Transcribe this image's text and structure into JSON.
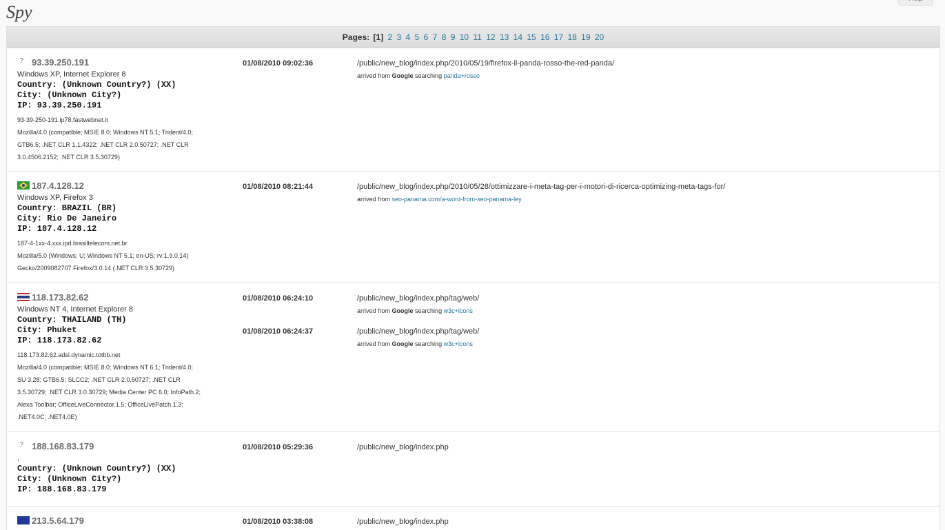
{
  "title": "Spy",
  "help_label": "Help",
  "pager": {
    "label": "Pages:",
    "current": "[1]",
    "pages": [
      "2",
      "3",
      "4",
      "5",
      "6",
      "7",
      "8",
      "9",
      "10",
      "11",
      "12",
      "13",
      "14",
      "15",
      "16",
      "17",
      "18",
      "19",
      "20"
    ]
  },
  "visits": [
    {
      "flag": "unknown",
      "flag_text": "?",
      "ip": "93.39.250.191",
      "os": "Windows XP, Internet Explorer 8",
      "country": "Country: (Unknown Country?) (XX)",
      "city": "City: (Unknown City?)",
      "ip_line": "IP: 93.39.250.191",
      "host": "93-39-250-191.ip78.fastwebnet.it",
      "ua": [
        "Mozilla/4.0 (compatible; MSIE 8.0; Windows NT 5.1; Trident/4.0;",
        "GTB6.5; .NET CLR 1.1.4322; .NET CLR 2.0.50727; .NET CLR",
        "3.0.4506.2152; .NET CLR 3.5.30729)"
      ],
      "hits": [
        {
          "time": "01/08/2010 09:02:36",
          "url": "/public/new_blog/index.php/2010/05/19/firefox-il-panda-rosso-the-red-panda/",
          "ref_prefix": "arrived from",
          "ref_engine": "Google",
          "ref_mid": "searching",
          "ref_link": "panda+rosso"
        }
      ]
    },
    {
      "flag": "br",
      "ip": "187.4.128.12",
      "os": "Windows XP, Firefox 3",
      "country": "Country: BRAZIL (BR)",
      "city": "City: Rio De Janeiro",
      "ip_line": "IP: 187.4.128.12",
      "host": "187-4-1xx-4.xxx.ipd.brasiltelecom.net.br",
      "ua": [
        "Mozilla/5.0 (Windows; U; Windows NT 5.1; en-US; rv:1.9.0.14)",
        "Gecko/2009082707 Firefox/3.0.14 (.NET CLR 3.5.30729)"
      ],
      "hits": [
        {
          "time": "01/08/2010 08:21:44",
          "url": "/public/new_blog/index.php/2010/05/28/ottimizzare-i-meta-tag-per-i-motori-di-ricerca-optimizing-meta-tags-for/",
          "ref_prefix": "arrived from",
          "ref_engine": "",
          "ref_mid": "",
          "ref_link": "seo-panama.com/a-word-from-seo-panama-ley"
        }
      ]
    },
    {
      "flag": "th",
      "ip": "118.173.82.62",
      "os": "Windows NT 4, Internet Explorer 8",
      "country": "Country: THAILAND (TH)",
      "city": "City: Phuket",
      "ip_line": "IP: 118.173.82.62",
      "host": "118.173.82.62.adsl.dynamic.totbb.net",
      "ua": [
        "Mozilla/4.0 (compatible; MSIE 8.0; Windows NT 6.1; Trident/4.0;",
        "SU 3.28; GTB6.5; SLCC2; .NET CLR 2.0.50727; .NET CLR",
        "3.5.30729; .NET CLR 3.0.30729; Media Center PC 6.0; InfoPath.2;",
        "Alexa Toolbar; OfficeLiveConnector.1.5; OfficeLivePatch.1.3;",
        ".NET4.0C; .NET4.0E)"
      ],
      "hits": [
        {
          "time": "01/08/2010 06:24:10",
          "url": "/public/new_blog/index.php/tag/web/",
          "ref_prefix": "arrived from",
          "ref_engine": "Google",
          "ref_mid": "searching",
          "ref_link": "w3c+icons"
        },
        {
          "time": "01/08/2010 06:24:37",
          "url": "/public/new_blog/index.php/tag/web/",
          "ref_prefix": "arrived from",
          "ref_engine": "Google",
          "ref_mid": "searching",
          "ref_link": "w3c+icons"
        }
      ]
    },
    {
      "flag": "unknown",
      "flag_text": "?",
      "ip": "188.168.83.179",
      "os": ",",
      "country": "Country: (Unknown Country?) (XX)",
      "city": "City: (Unknown City?)",
      "ip_line": "IP: 188.168.83.179",
      "hits": [
        {
          "time": "01/08/2010 05:29:36",
          "url": "/public/new_blog/index.php"
        }
      ]
    },
    {
      "flag": "eu",
      "ip": "213.5.64.179",
      "hits": [
        {
          "time": "01/08/2010 03:38:08",
          "url": "/public/new_blog/index.php"
        }
      ]
    }
  ]
}
